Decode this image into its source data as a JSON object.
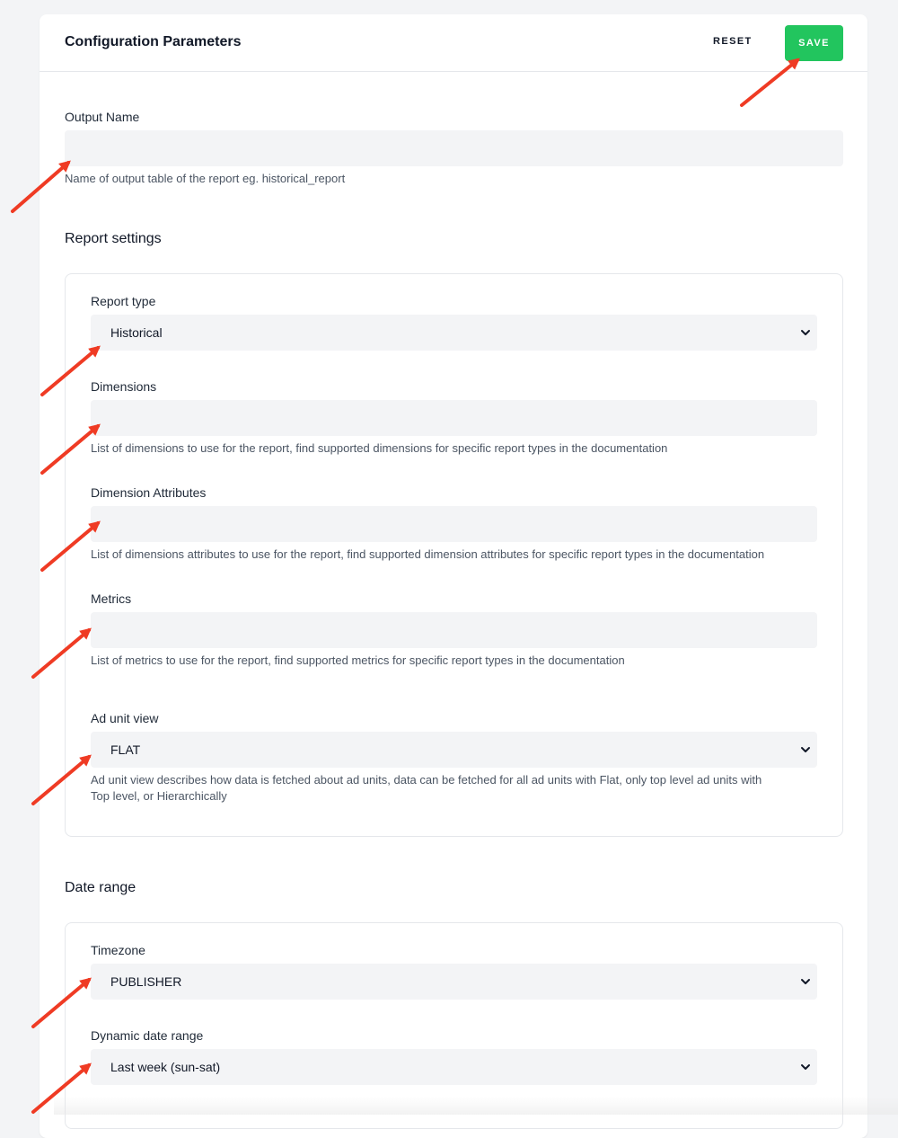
{
  "header": {
    "title": "Configuration Parameters",
    "reset_label": "RESET",
    "save_label": "SAVE"
  },
  "output": {
    "label": "Output Name",
    "value": "",
    "help": "Name of output table of the report eg. historical_report"
  },
  "report_settings": {
    "heading": "Report settings",
    "report_type": {
      "label": "Report type",
      "value": "Historical"
    },
    "dimensions": {
      "label": "Dimensions",
      "value": "",
      "help": "List of dimensions to use for the report, find supported dimensions for specific report types in the documentation"
    },
    "dimension_attributes": {
      "label": "Dimension Attributes",
      "value": "",
      "help": "List of dimensions attributes to use for the report, find supported dimension attributes for specific report types in the documentation"
    },
    "metrics": {
      "label": "Metrics",
      "value": "",
      "help": "List of metrics to use for the report, find supported metrics for specific report types in the documentation"
    },
    "ad_unit_view": {
      "label": "Ad unit view",
      "value": "FLAT",
      "help_line1": "Ad unit view describes how data is fetched about ad units, data can be fetched for all ad units with Flat, only top level ad units with",
      "help_line2": "Top level, or Hierarchically"
    }
  },
  "date_range": {
    "heading": "Date range",
    "timezone": {
      "label": "Timezone",
      "value": "PUBLISHER"
    },
    "dynamic_date_range": {
      "label": "Dynamic date range",
      "value": "Last week (sun-sat)"
    }
  },
  "colors": {
    "save_button": "#22c55e",
    "annotation_arrow": "#ef3b24",
    "field_background": "#f3f4f6"
  }
}
